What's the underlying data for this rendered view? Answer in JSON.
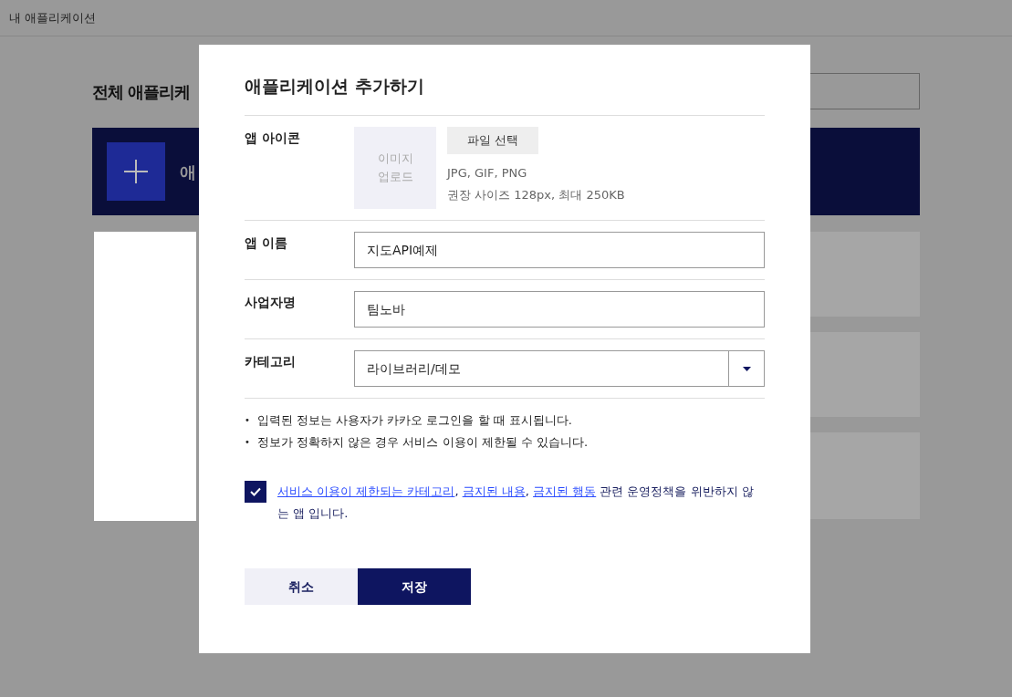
{
  "header": {
    "title": "내 애플리케이션"
  },
  "background": {
    "page_title": "전체 애플리케",
    "add_bar_label": "애"
  },
  "modal": {
    "title": "애플리케이션 추가하기",
    "icon_field": {
      "label": "앱 아이콘",
      "placeholder": "이미지\n업로드",
      "button": "파일 선택",
      "hints": [
        "JPG, GIF, PNG",
        "권장 사이즈 128px, 최대 250KB"
      ]
    },
    "fields": [
      {
        "kind": "text",
        "label": "앱 이름",
        "value": "지도API예제"
      },
      {
        "kind": "text",
        "label": "사업자명",
        "value": "팀노바"
      },
      {
        "kind": "select",
        "label": "카테고리",
        "value": "라이브러리/데모"
      }
    ],
    "notes": [
      {
        "bullet": "•",
        "text": "입력된 정보는 사용자가 카카오 로그인을 할 때 표시됩니다."
      },
      {
        "bullet": "•",
        "text": "정보가 정확하지 않은 경우 서비스 이용이 제한될 수 있습니다."
      }
    ],
    "agreement": {
      "checked": true,
      "parts": [
        {
          "kind": "link",
          "text": "서비스 이용이 제한되는 카테고리"
        },
        {
          "kind": "text",
          "text": ", "
        },
        {
          "kind": "link",
          "text": "금지된 내용"
        },
        {
          "kind": "text",
          "text": ", "
        },
        {
          "kind": "link",
          "text": "금지된 행동"
        },
        {
          "kind": "text",
          "text": " 관련 운영정책을 위반하지 않는 앱 입니다."
        }
      ]
    },
    "buttons": [
      {
        "kind": "secondary",
        "label": "취소"
      },
      {
        "kind": "primary",
        "label": "저장"
      }
    ]
  }
}
